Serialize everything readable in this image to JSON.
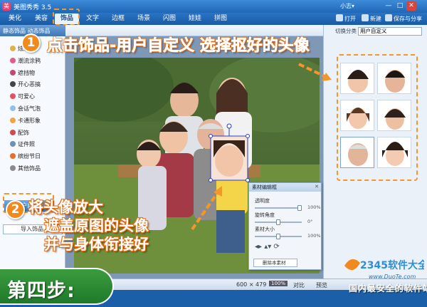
{
  "window": {
    "title": "美图秀秀 3.5",
    "user_label": "小志▾",
    "controls": [
      "—",
      "□",
      "✕"
    ]
  },
  "menu": {
    "tabs": [
      "美化",
      "美容",
      "饰品",
      "文字",
      "边框",
      "场景",
      "闪图",
      "娃娃",
      "拼图"
    ],
    "active_tab": "饰品",
    "actions": {
      "open": "打开",
      "new": "新建",
      "save_share": "保存与分享"
    }
  },
  "left_panel": {
    "header": "静态饰品  动态饰品",
    "items": [
      "炫彩",
      "潮流涂鸦",
      "遮挡物",
      "开心恶搞",
      "可爱心",
      "会话气泡",
      "卡通形象",
      "配饰",
      "证件照",
      "缤纷节日",
      "其他饰品"
    ],
    "selected_item": "用户自定义",
    "search_placeholder": "导入饰品"
  },
  "right_panel": {
    "switch_label": "切换分类",
    "category_value": "用户自定义",
    "thumb_count": 6
  },
  "edit_dialog": {
    "title": "素材编辑框",
    "close": "✕",
    "opacity_label": "透明度",
    "opacity_value": "100%",
    "rotate_label": "旋转角度",
    "rotate_value": "0°",
    "size_label": "素材大小",
    "size_value": "100%",
    "delete_label": "删除本素材",
    "opacity": 1.0,
    "rotate": 0,
    "size": 1.0
  },
  "status_bar": {
    "dimensions": "600 × 479",
    "zoom_label": "100%",
    "compare_label": "对比",
    "preview_label": "预览"
  },
  "annotations": {
    "step1_number": "1",
    "step1_text": "点击饰品-用户自定义 选择抠好的头像",
    "step2_number": "2",
    "step2_line1": "将头像放大",
    "step2_line2": "遮盖原图的头像",
    "step2_line3": "并与身体衔接好",
    "step4_label": "第四步:",
    "watermark_site": "www.DuoTe.com",
    "watermark_brand": "2345软件大全",
    "watermark_slogan": "国内最安全的软件站"
  },
  "colors": {
    "titlebar": "#1f67b8",
    "accent_orange": "#f5962a",
    "step4_green": "#2a8c32",
    "panel_bg": "#eaf1f9"
  }
}
